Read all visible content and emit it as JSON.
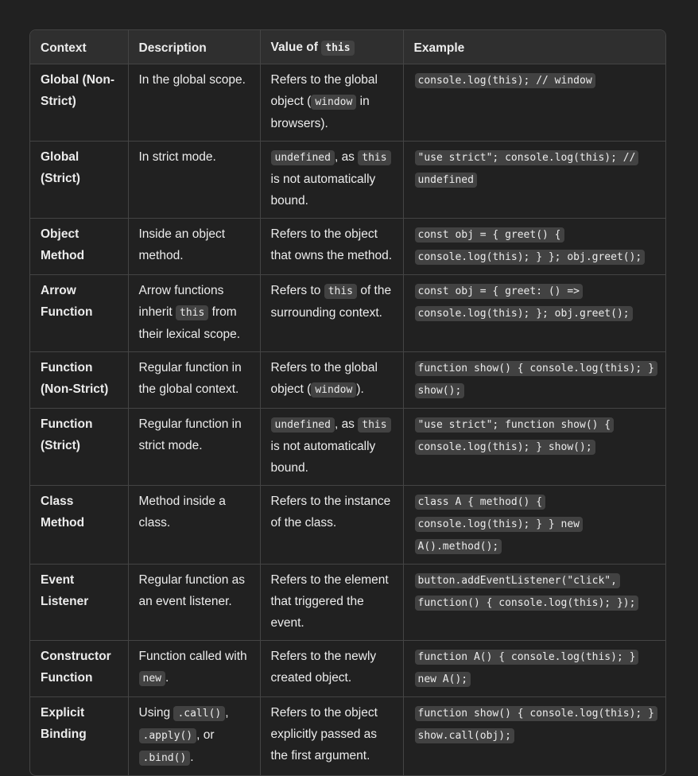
{
  "headers": {
    "context": "Context",
    "description": "Description",
    "value_prefix": "Value of ",
    "value_code": "this",
    "example": "Example"
  },
  "rows": [
    {
      "context": "Global (Non-Strict)",
      "description": "In the global scope.",
      "value": [
        {
          "t": "Refers to the global object ("
        },
        {
          "c": "window"
        },
        {
          "t": " in browsers)."
        }
      ],
      "example": "console.log(this); // window"
    },
    {
      "context": "Global (Strict)",
      "description": "In strict mode.",
      "value": [
        {
          "c": "undefined"
        },
        {
          "t": ", as "
        },
        {
          "c": "this"
        },
        {
          "t": " is not automatically bound."
        }
      ],
      "example": "\"use strict\"; console.log(this); // undefined"
    },
    {
      "context": "Object Method",
      "description": "Inside an object method.",
      "value": [
        {
          "t": "Refers to the object that owns the method."
        }
      ],
      "example": "const obj = { greet() { console.log(this); } }; obj.greet();"
    },
    {
      "context": "Arrow Function",
      "description": [
        {
          "t": "Arrow functions inherit "
        },
        {
          "c": "this"
        },
        {
          "t": " from their lexical scope."
        }
      ],
      "value": [
        {
          "t": "Refers to "
        },
        {
          "c": "this"
        },
        {
          "t": " of the surrounding context."
        }
      ],
      "example": "const obj = { greet: () => console.log(this); }; obj.greet();"
    },
    {
      "context": "Function (Non-Strict)",
      "description": "Regular function in the global context.",
      "value": [
        {
          "t": "Refers to the global object ("
        },
        {
          "c": "window"
        },
        {
          "t": ")."
        }
      ],
      "example": "function show() { console.log(this); } show();"
    },
    {
      "context": "Function (Strict)",
      "description": "Regular function in strict mode.",
      "value": [
        {
          "c": "undefined"
        },
        {
          "t": ", as "
        },
        {
          "c": "this"
        },
        {
          "t": " is not automatically bound."
        }
      ],
      "example": "\"use strict\"; function show() { console.log(this); } show();"
    },
    {
      "context": "Class Method",
      "description": "Method inside a class.",
      "value": [
        {
          "t": "Refers to the instance of the class."
        }
      ],
      "example": "class A { method() { console.log(this); } } new A().method();"
    },
    {
      "context": "Event Listener",
      "description": "Regular function as an event listener.",
      "value": [
        {
          "t": "Refers to the element that triggered the event."
        }
      ],
      "example": "button.addEventListener(\"click\", function() { console.log(this); });"
    },
    {
      "context": "Constructor Function",
      "description": [
        {
          "t": "Function called with "
        },
        {
          "c": "new"
        },
        {
          "t": "."
        }
      ],
      "value": [
        {
          "t": "Refers to the newly created object."
        }
      ],
      "example": "function A() { console.log(this); } new A();"
    },
    {
      "context": "Explicit Binding",
      "description": [
        {
          "t": "Using "
        },
        {
          "c": ".call()"
        },
        {
          "t": ", "
        },
        {
          "c": ".apply()"
        },
        {
          "t": ", or "
        },
        {
          "c": ".bind()"
        },
        {
          "t": "."
        }
      ],
      "value": [
        {
          "t": "Refers to the object explicitly passed as the first argument."
        }
      ],
      "example": "function show() { console.log(this); } show.call(obj);"
    }
  ]
}
